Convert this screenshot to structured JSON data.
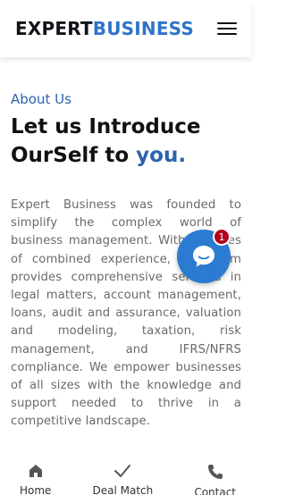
{
  "header": {
    "logo_part1": "EXPERT",
    "logo_part2": "BUSINESS"
  },
  "about": {
    "eyebrow": "About Us",
    "headline_line1": "Let us Introduce",
    "headline_line2": "OurSelf to",
    "headline_accent": "you."
  },
  "paragraph": "Expert Business was founded to simplify the complex world of business management. With decades of combined experience, our team provides comprehensive services in legal matters, account management, loans, audit and assurance, valuation and modeling, taxation, risk management, and IFRS/NFRS compliance. We empower businesses of all sizes with the knowledge and support needed to thrive in a competitive landscape.",
  "chat": {
    "badge": "1"
  },
  "bottom_nav": {
    "items": [
      {
        "label": "Home",
        "icon": "home-icon"
      },
      {
        "label": "Deal Match",
        "icon": "check-icon"
      },
      {
        "label": "Contact",
        "icon": "phone-icon"
      }
    ]
  },
  "colors": {
    "brand_blue": "#2f73c9",
    "accent_blue": "#2a63ad",
    "chat_blue": "#2b7bd0",
    "badge_red": "#b3001b"
  }
}
